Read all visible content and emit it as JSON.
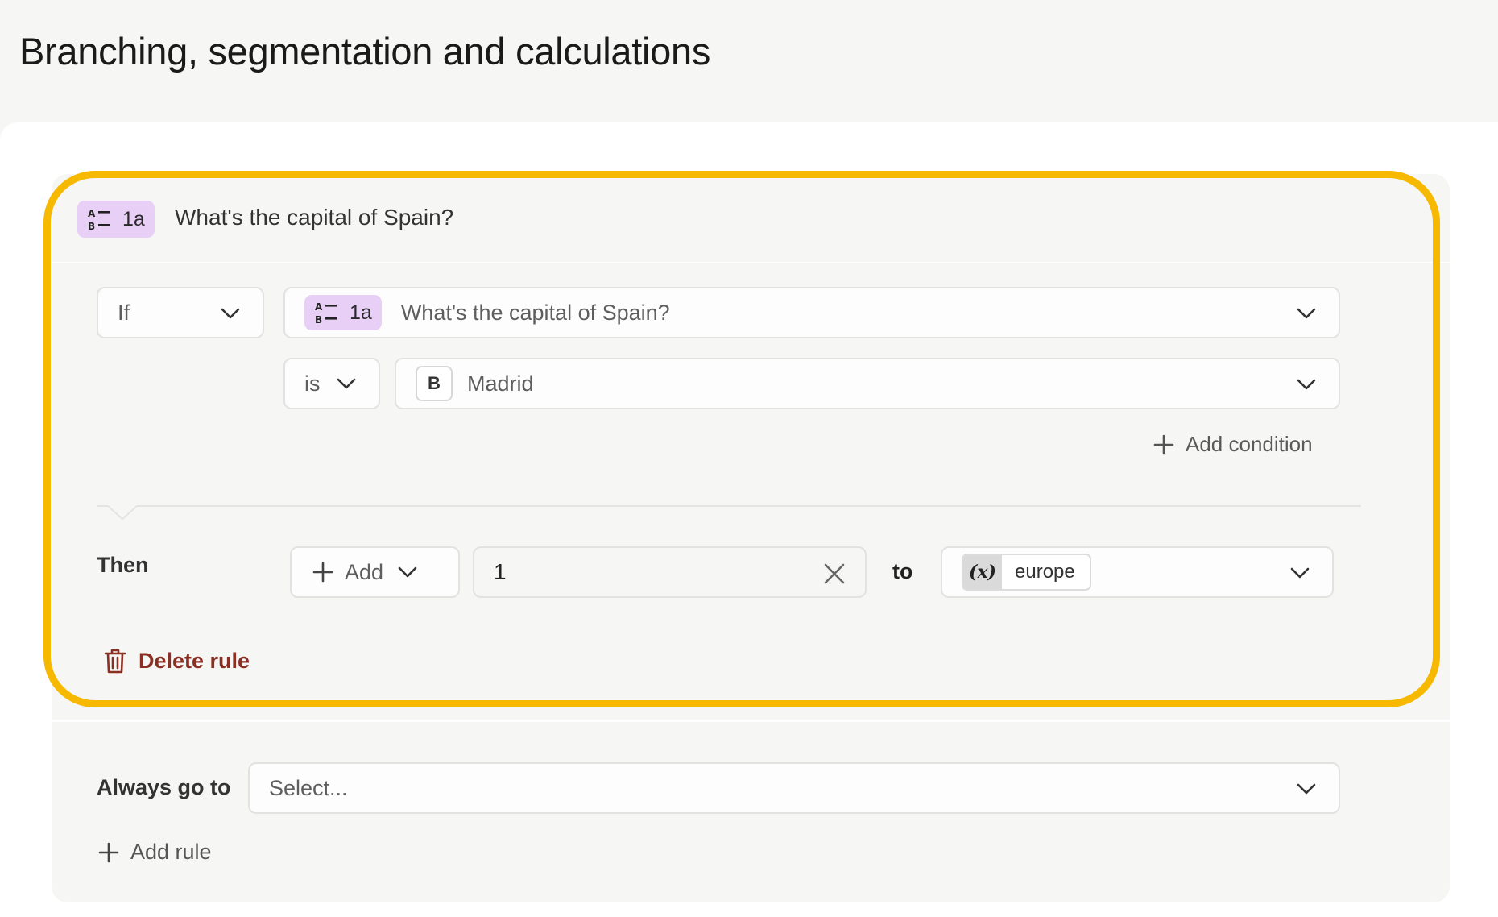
{
  "page": {
    "title": "Branching, segmentation and calculations"
  },
  "question": {
    "ref": "1a",
    "title": "What's the capital of Spain?"
  },
  "rule": {
    "if_label": "If",
    "question_ref": "1a",
    "question_title": "What's the capital of Spain?",
    "operator": "is",
    "answer_key": "B",
    "answer_value": "Madrid",
    "add_condition_label": "Add condition",
    "then_label": "Then",
    "action_label": "Add",
    "action_value": "1",
    "to_label": "to",
    "variable_symbol": "(x)",
    "variable_name": "europe",
    "delete_rule_label": "Delete rule"
  },
  "fallback": {
    "always_go_to_label": "Always go to",
    "select_placeholder": "Select..."
  },
  "add_rule_label": "Add rule",
  "colors": {
    "highlight": "#f6b900",
    "badge": "#e8cff6",
    "delete": "#8a2f22"
  }
}
